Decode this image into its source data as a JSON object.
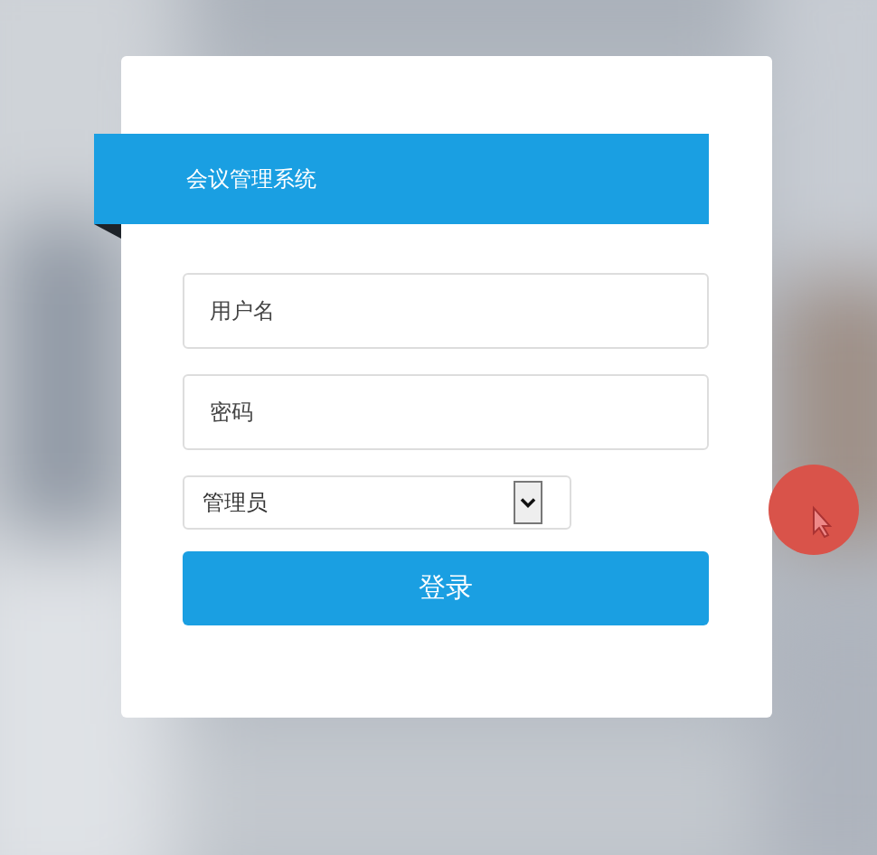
{
  "title": "会议管理系统",
  "fields": [
    {
      "placeholder": "用户名"
    },
    {
      "placeholder": "密码"
    }
  ],
  "role_select": {
    "value": "管理员"
  },
  "login_button": "登录"
}
